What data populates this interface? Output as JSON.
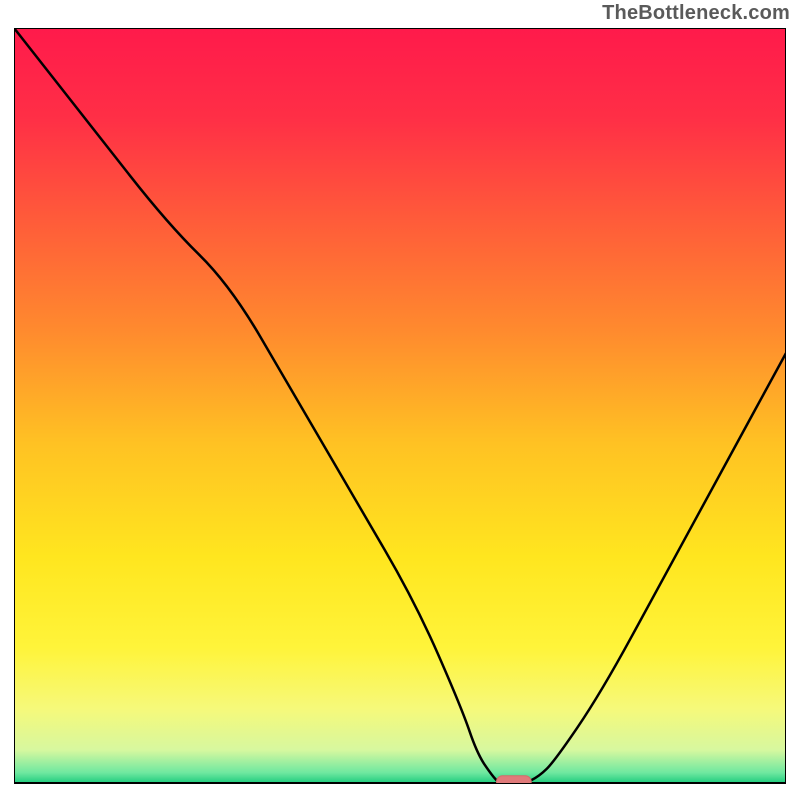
{
  "watermark": "TheBottleneck.com",
  "colors": {
    "gradient_stops": [
      {
        "offset": 0.0,
        "color": "#ff1a4b"
      },
      {
        "offset": 0.12,
        "color": "#ff2f46"
      },
      {
        "offset": 0.25,
        "color": "#ff5a3a"
      },
      {
        "offset": 0.4,
        "color": "#ff8a2e"
      },
      {
        "offset": 0.55,
        "color": "#ffc223"
      },
      {
        "offset": 0.7,
        "color": "#ffe61f"
      },
      {
        "offset": 0.82,
        "color": "#fff43a"
      },
      {
        "offset": 0.9,
        "color": "#f6f97a"
      },
      {
        "offset": 0.955,
        "color": "#d7f89f"
      },
      {
        "offset": 0.985,
        "color": "#6fe8a0"
      },
      {
        "offset": 1.0,
        "color": "#18c97b"
      }
    ],
    "curve": "#000000",
    "baseline": "#000000",
    "marker_fill": "#e07a7a",
    "marker_stroke": "#d46a6a",
    "frame_stroke": "#000000"
  },
  "chart_data": {
    "type": "line",
    "title": "",
    "xlabel": "",
    "ylabel": "",
    "xlim": [
      0,
      100
    ],
    "ylim": [
      0,
      100
    ],
    "series": [
      {
        "name": "bottleneck-curve",
        "x": [
          0,
          10,
          20,
          28,
          36,
          44,
          52,
          58,
          60,
          62,
          63,
          66,
          68,
          70,
          76,
          84,
          92,
          100
        ],
        "values": [
          100,
          87,
          74,
          66,
          52,
          38,
          24,
          10,
          4,
          1,
          0,
          0,
          1,
          3,
          12,
          27,
          42,
          57
        ]
      }
    ],
    "marker": {
      "x_start": 62.5,
      "x_end": 67.0,
      "y": 0.3
    },
    "annotations": []
  }
}
